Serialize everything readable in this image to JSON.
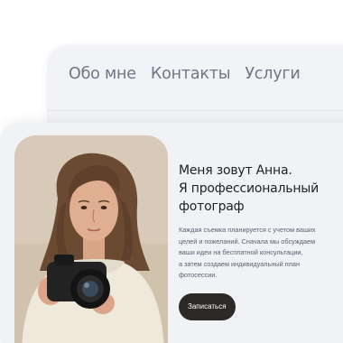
{
  "nav": {
    "items": [
      "Обо мне",
      "Контакты",
      "Услуги"
    ]
  },
  "hero": {
    "title_line1": "Меня зовут Анна.",
    "title_line2": "Я профессиональный",
    "title_line3": "фотограф",
    "description": "Каждая съемка планируется с учетом ваших\nцелей и пожеланий. Сначала мы обсуждаем\nваши идеи на бесплатной консультации,\nа затем создаем индивидуальный план\nфотосессии.",
    "cta_label": "Записаться"
  },
  "colors": {
    "page_background": "#ffffff",
    "card_background": "#f1f2f5",
    "nav_text": "#6f7685",
    "heading_text": "#1d1f24",
    "body_text": "#5b6070",
    "button_background": "#2c2927",
    "button_text": "#ffffff"
  }
}
